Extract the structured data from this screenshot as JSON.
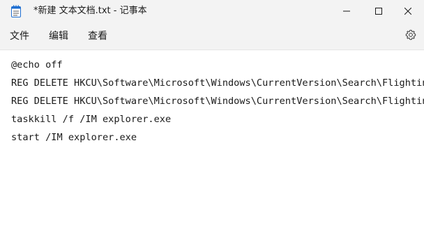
{
  "window": {
    "title": "*新建 文本文档.txt - 记事本",
    "app_icon": "notepad-icon",
    "controls": {
      "minimize_icon": "minimize-icon",
      "maximize_icon": "maximize-icon",
      "close_icon": "close-icon"
    }
  },
  "menu": {
    "items": [
      {
        "label": "文件"
      },
      {
        "label": "编辑"
      },
      {
        "label": "查看"
      }
    ],
    "settings_icon": "gear-icon"
  },
  "editor": {
    "lines": [
      "@echo off",
      "REG DELETE HKCU\\Software\\Microsoft\\Windows\\CurrentVersion\\Search\\Flighting",
      "REG DELETE HKCU\\Software\\Microsoft\\Windows\\CurrentVersion\\Search\\Flighting",
      "taskkill /f /IM explorer.exe",
      "start /IM explorer.exe"
    ]
  },
  "colors": {
    "chrome_background": "#f3f3f3",
    "editor_background": "#ffffff",
    "text": "#1a1a1a",
    "icon_blue": "#1f6fd1"
  }
}
